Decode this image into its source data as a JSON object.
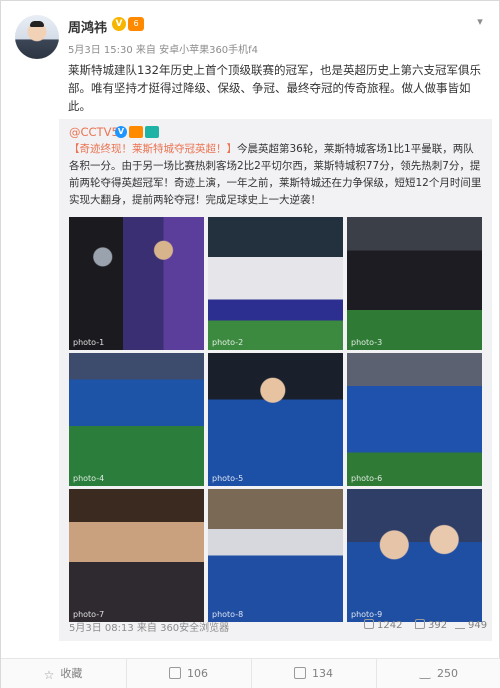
{
  "post": {
    "author": "周鸿祎",
    "v_badge": "V",
    "vip_badge": "6",
    "meta": "5月3日 15:30 来自 安卓小苹果360手机f4",
    "text": "莱斯特城建队132年历史上首个顶级联赛的冠军，也是英超历史上第六支冠军俱乐部。唯有坚持才挺得过降级、保级、争冠、最终夺冠的传奇旅程。做人做事皆如此。"
  },
  "repost": {
    "handle": "@CCTV5",
    "v_badge": "V",
    "text_highlight": "【奇迹终现！莱斯特城夺冠英超！】",
    "text_body": "今晨英超第36轮，莱斯特城客场1比1平曼联，两队各积一分。由于另一场比赛热刺客场2比2平切尔西，莱斯特城积77分，领先热刺7分，提前两轮夺得英超冠军！奇迹上演，一年之前，莱斯特城还在力争保级，短短12个月时间里实现大翻身，提前两轮夺冠！完成足球史上一大逆袭！",
    "meta": "5月3日 08:13 来自 360安全浏览器",
    "shares": "1242",
    "comments": "392",
    "likes": "949",
    "images": [
      "photo-1",
      "photo-2",
      "photo-3",
      "photo-4",
      "photo-5",
      "photo-6",
      "photo-7",
      "photo-8",
      "photo-9"
    ]
  },
  "footer": {
    "favorite": "收藏",
    "share": "106",
    "comment": "134",
    "like": "250"
  },
  "colors": {
    "accent": "#eb7350",
    "muted": "#8c8c8c",
    "repost_bg": "#f2f2f5"
  }
}
